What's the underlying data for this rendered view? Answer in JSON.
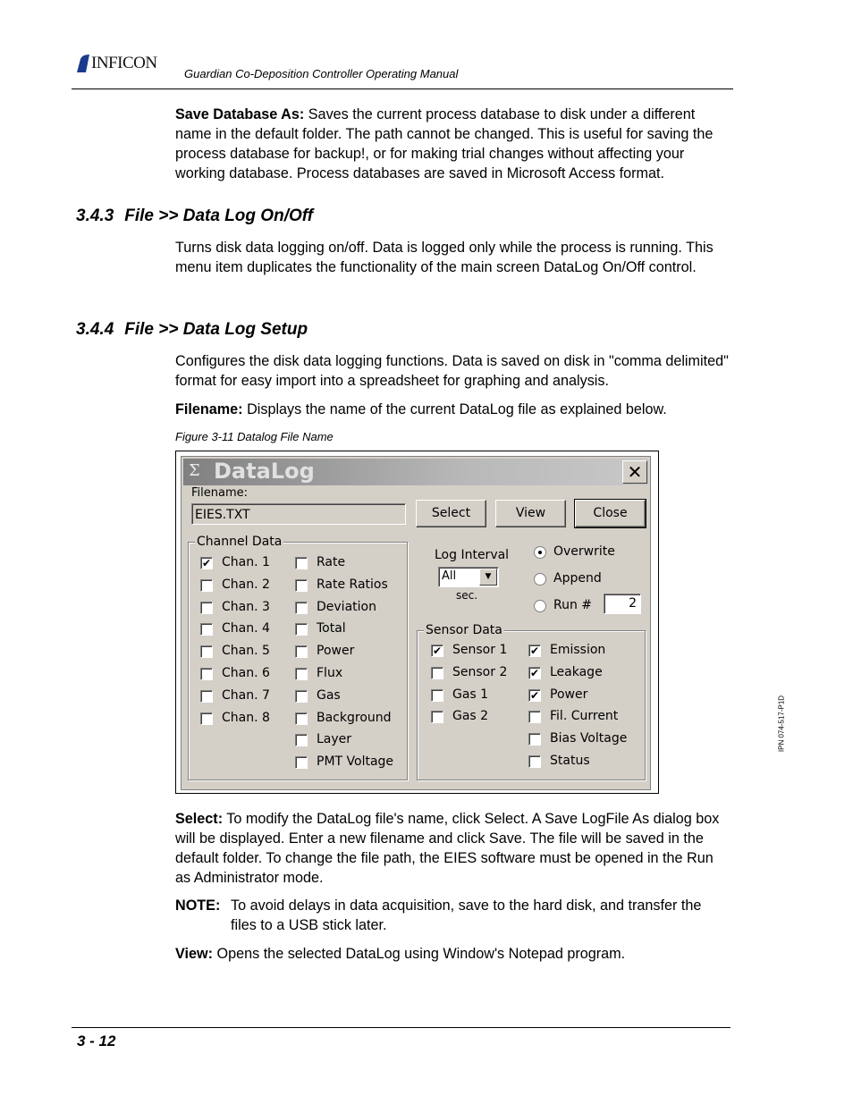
{
  "header": {
    "brand": "INFICON",
    "manual_title": "Guardian Co-Deposition Controller Operating Manual"
  },
  "intro": {
    "term": "Save Database As:",
    "text": " Saves the current process database to disk under a different name in the default folder. The path cannot be changed. This is useful for saving the process database for backup!, or for making trial changes without affecting your working database. Process databases are saved in Microsoft Access format."
  },
  "sec343": {
    "num": "3.4.3",
    "title": "File >> Data Log On/Off",
    "body": "Turns disk data logging on/off. Data is logged only while the process is running. This menu item duplicates the functionality of the main screen DataLog On/Off control."
  },
  "sec344": {
    "num": "3.4.4",
    "title": "File >> Data Log Setup",
    "body": "Configures the disk data logging functions. Data is saved on disk in \"comma delimited\" format for easy import into a spreadsheet for graphing and analysis.",
    "filename_term": "Filename:",
    "filename_text": " Displays the name of the current DataLog file as explained below."
  },
  "figure_caption": "Figure 3-11  Datalog File Name",
  "dialog": {
    "title": "DataLog",
    "title_icon": "sigma-icon",
    "filename_label": "Filename:",
    "filename_value": "EIES.TXT",
    "buttons": {
      "select": "Select",
      "view": "View",
      "close": "Close"
    },
    "channel_group": "Channel Data",
    "channels": [
      {
        "label": "Chan. 1",
        "checked": true
      },
      {
        "label": "Chan. 2",
        "checked": false
      },
      {
        "label": "Chan. 3",
        "checked": false
      },
      {
        "label": "Chan. 4",
        "checked": false
      },
      {
        "label": "Chan. 5",
        "checked": false
      },
      {
        "label": "Chan. 6",
        "checked": false
      },
      {
        "label": "Chan. 7",
        "checked": false
      },
      {
        "label": "Chan. 8",
        "checked": false
      }
    ],
    "channel_fields": [
      {
        "label": "Rate",
        "checked": false
      },
      {
        "label": "Rate Ratios",
        "checked": false
      },
      {
        "label": "Deviation",
        "checked": false
      },
      {
        "label": "Total",
        "checked": false
      },
      {
        "label": "Power",
        "checked": false
      },
      {
        "label": "Flux",
        "checked": false
      },
      {
        "label": "Gas",
        "checked": false
      },
      {
        "label": "Background",
        "checked": false
      },
      {
        "label": "Layer",
        "checked": false
      },
      {
        "label": "PMT Voltage",
        "checked": false
      }
    ],
    "log_interval_label": "Log Interval",
    "log_interval_value": "All",
    "log_interval_unit": "sec.",
    "modes": [
      {
        "label": "Overwrite",
        "selected": true
      },
      {
        "label": "Append",
        "selected": false
      },
      {
        "label": "Run #",
        "selected": false
      }
    ],
    "run_number": "2",
    "sensor_group": "Sensor Data",
    "sensors": [
      {
        "label": "Sensor 1",
        "checked": true
      },
      {
        "label": "Sensor 2",
        "checked": false
      },
      {
        "label": "Gas 1",
        "checked": false
      },
      {
        "label": "Gas 2",
        "checked": false
      }
    ],
    "sensor_fields": [
      {
        "label": "Emission",
        "checked": true
      },
      {
        "label": "Leakage",
        "checked": true
      },
      {
        "label": "Power",
        "checked": true
      },
      {
        "label": "Fil. Current",
        "checked": false
      },
      {
        "label": "Bias Voltage",
        "checked": false
      },
      {
        "label": "Status",
        "checked": false
      }
    ]
  },
  "select_para": {
    "term": "Select:",
    "text": " To modify the DataLog file's name, click Select. A Save LogFile As dialog box will be displayed. Enter a new filename and click Save. The file will be saved in the default folder. To change the file path, the EIES software must be opened in the Run as Administrator mode."
  },
  "note": {
    "term": "NOTE:",
    "text": "To avoid delays in data acquisition, save to the hard disk, and transfer the files to a USB stick later."
  },
  "view_para": {
    "term": "View:",
    "text": " Opens the selected DataLog using Window's Notepad program."
  },
  "side_code": "IPN 074-517-P1D",
  "footer": {
    "page": "3 - 12"
  }
}
